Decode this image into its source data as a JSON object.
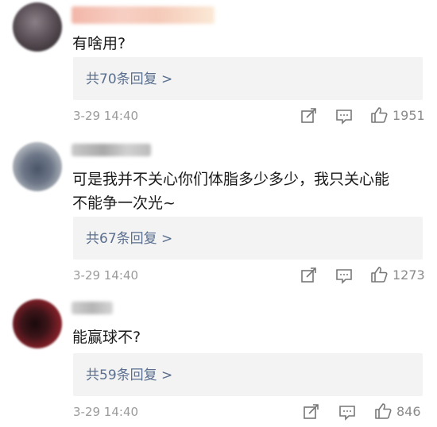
{
  "comments": [
    {
      "content": "有啥用?",
      "replies_label": "共70条回复 >",
      "timestamp": "3-29 14:40",
      "likes": "1951"
    },
    {
      "content": "可是我并不关心你们体脂多少多少，我只关心能\n不能争一次光~",
      "replies_label": "共67条回复 >",
      "timestamp": "3-29 14:40",
      "likes": "1273"
    },
    {
      "content": "能赢球不?",
      "replies_label": "共59条回复 >",
      "timestamp": "3-29 14:40",
      "likes": "846"
    }
  ],
  "icons": {
    "repost": "repost-icon",
    "comment": "comment-icon",
    "like": "thumbs-up-icon"
  }
}
